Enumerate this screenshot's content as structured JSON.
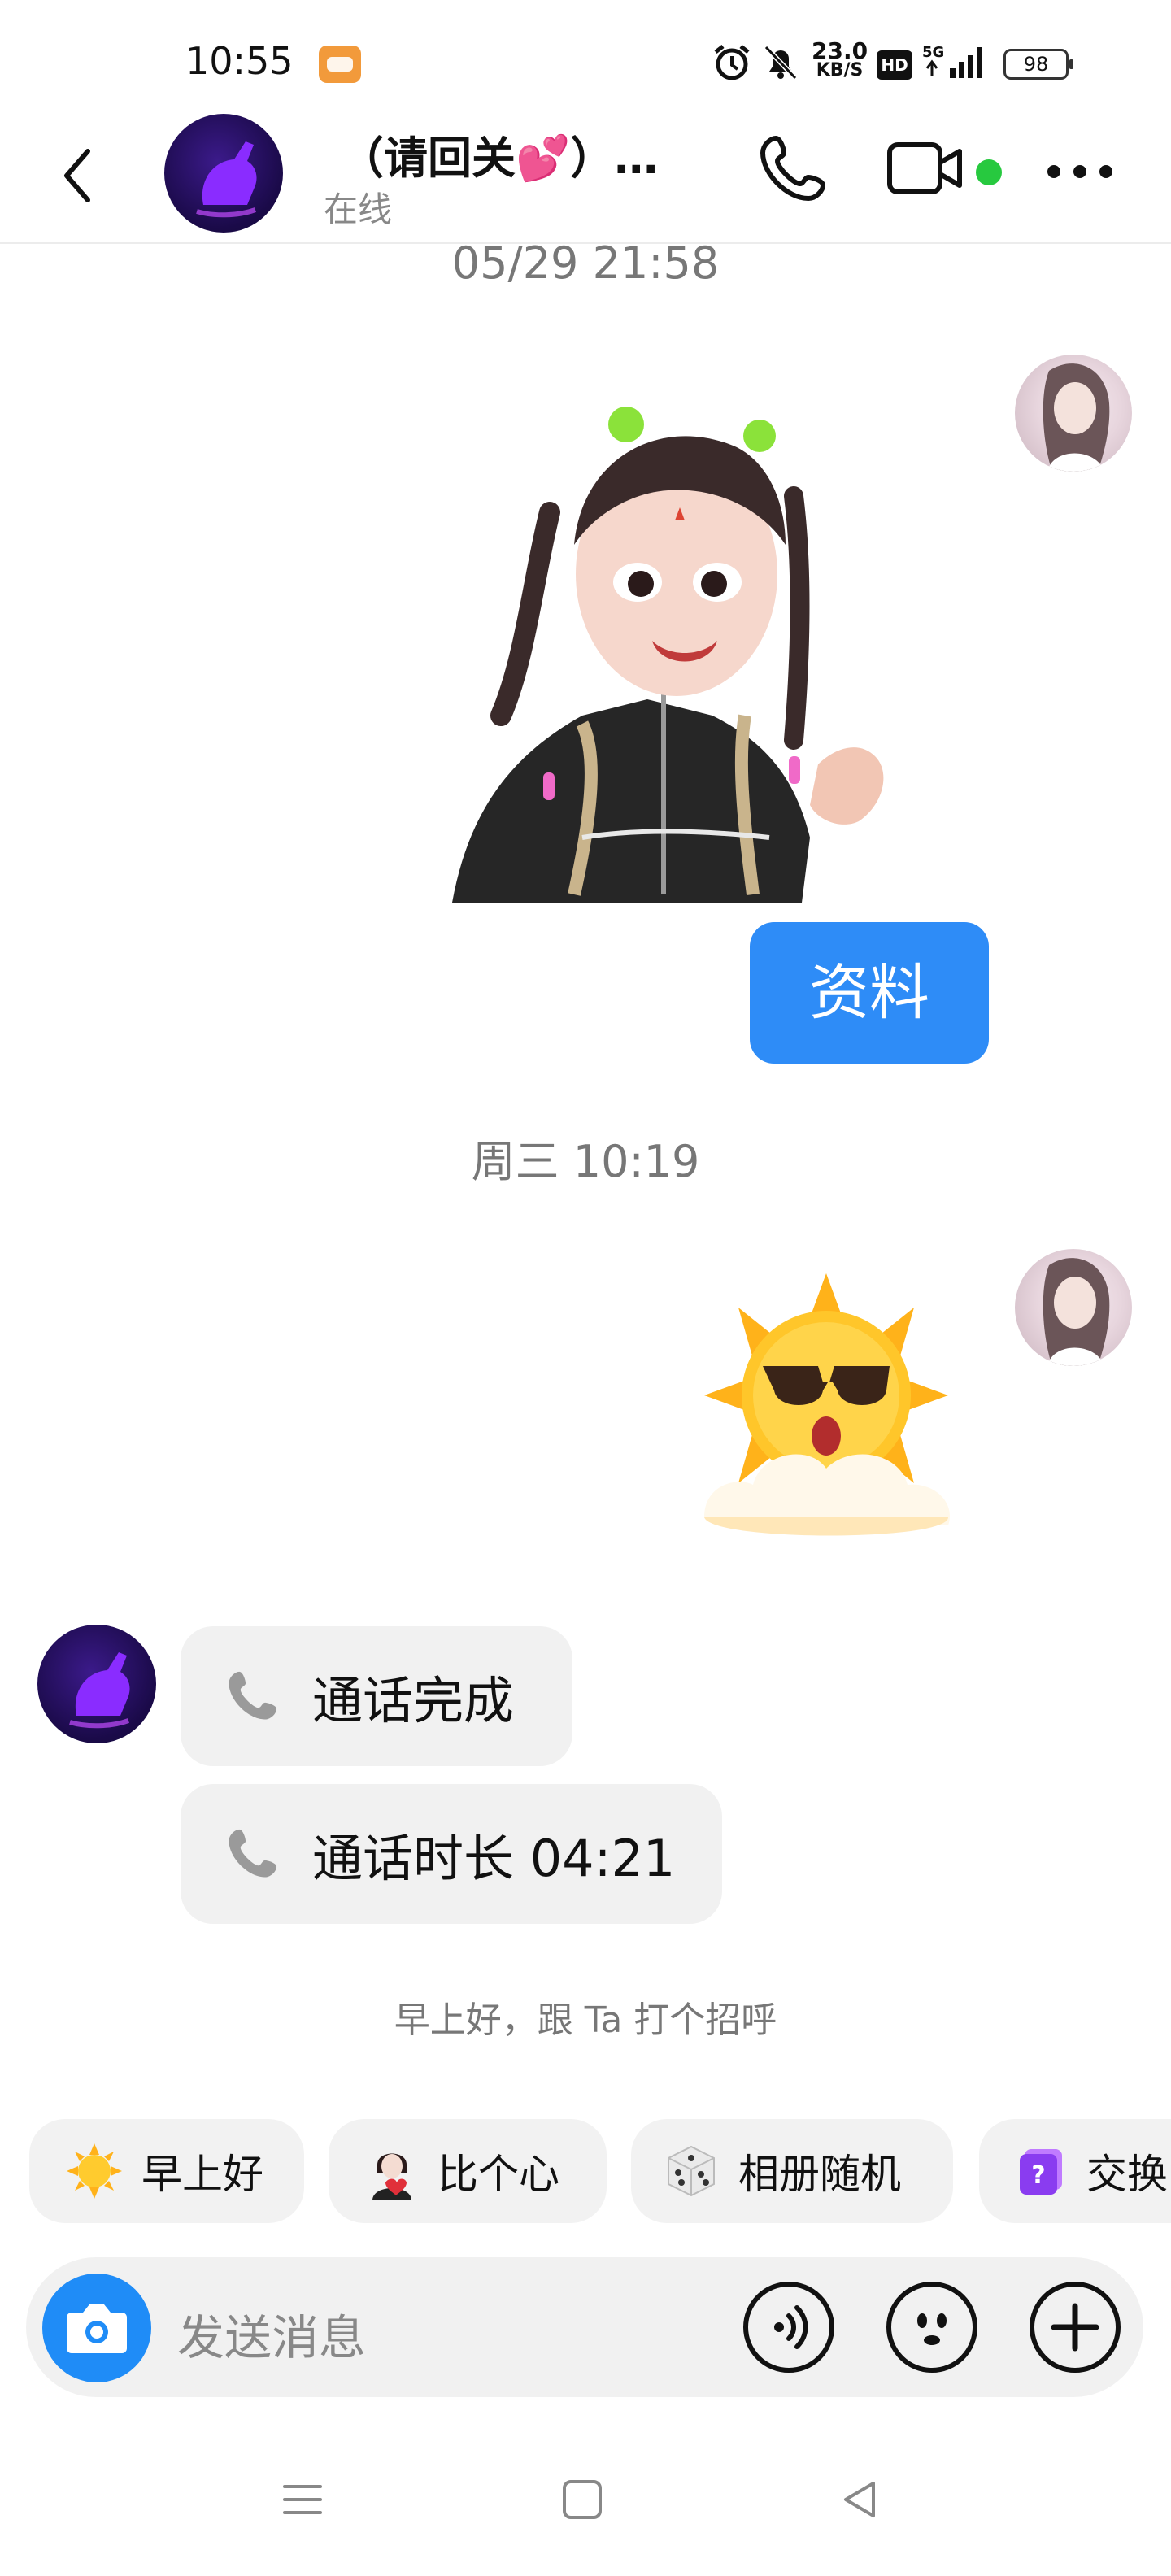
{
  "status_bar": {
    "time": "10:55",
    "net_speed_value": "23.0",
    "net_speed_unit": "KB/S",
    "hd_label": "HD",
    "signal_label": "5G",
    "battery": "98"
  },
  "header": {
    "title": "（请回关💕）…",
    "status": "在线",
    "online_dot_color": "#27c93f"
  },
  "messages": {
    "timestamp_1": "05/29 21:58",
    "bubble_text": "资料",
    "timestamp_2": "周三 10:19",
    "call_completed": "通话完成",
    "call_duration": "通话时长 04:21"
  },
  "hint": "早上好，跟 Ta 打个招呼",
  "quick_replies": [
    {
      "label": "早上好",
      "icon": "sun-emoji-icon"
    },
    {
      "label": "比个心",
      "icon": "heart-gesture-avatar-icon"
    },
    {
      "label": "相册随机",
      "icon": "dice-icon"
    },
    {
      "label": "交换",
      "icon": "question-card-icon"
    }
  ],
  "input_bar": {
    "placeholder": "发送消息"
  },
  "colors": {
    "accent_blue": "#2e8cf7",
    "bubble_grey": "#f1f1f1"
  }
}
